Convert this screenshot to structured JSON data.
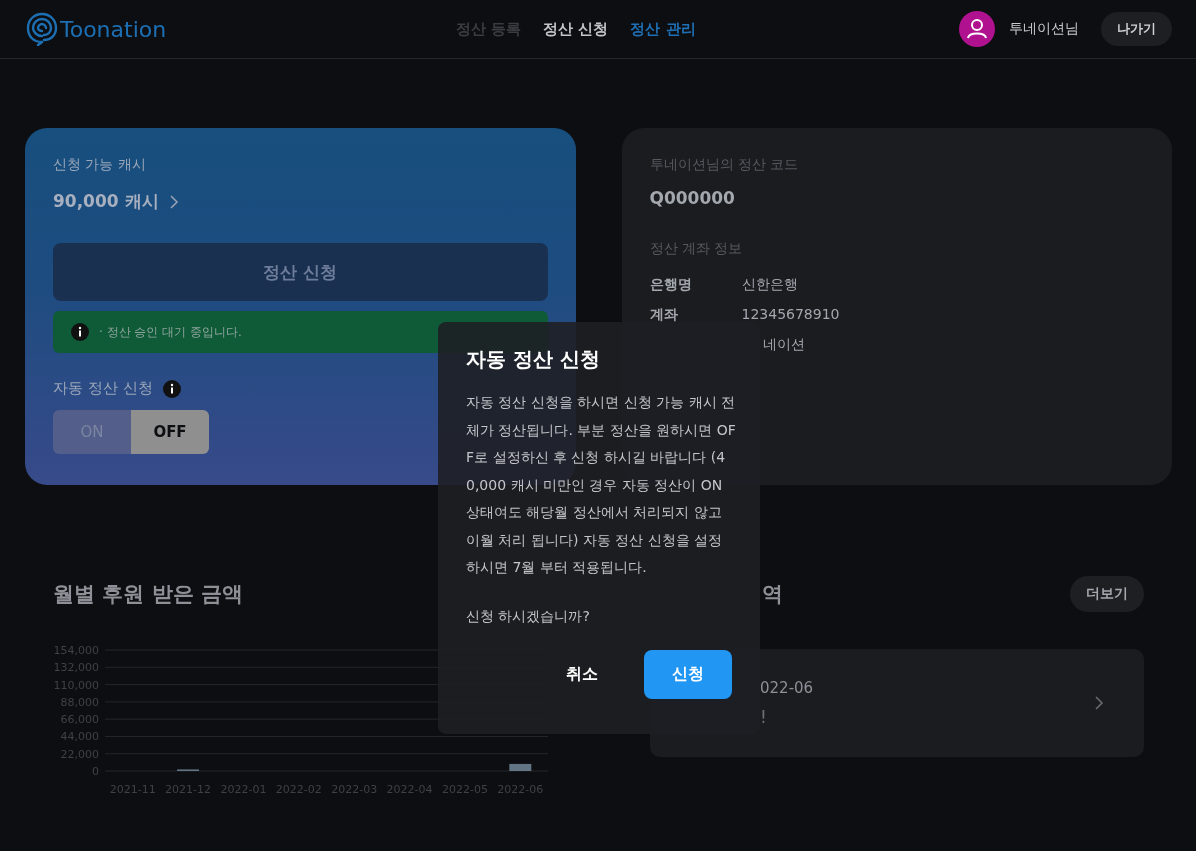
{
  "header": {
    "logo": "Toonation",
    "nav": [
      {
        "label": "정산 등록",
        "selected": false,
        "disabled": true
      },
      {
        "label": "정산 신청",
        "selected": false,
        "disabled": false
      },
      {
        "label": "정산 관리",
        "selected": true,
        "disabled": false
      }
    ],
    "user_name": "투네이션님",
    "logout": "나가기"
  },
  "cash_card": {
    "label": "신청 가능 캐시",
    "amount": "90,000 캐시",
    "apply_button": {
      "label": "정산 신청",
      "disabled": true
    },
    "notice": "· 정산 승인 대기 중입니다.",
    "auto_label": "자동 정산 신청",
    "toggle": [
      {
        "label": "ON",
        "selected": false
      },
      {
        "label": "OFF",
        "selected": true
      }
    ]
  },
  "code_card": {
    "title": "투네이션님의 정산 코드",
    "code": "Q000000",
    "account_title": "정산 계좌 정보",
    "rows": [
      {
        "label": "은행명",
        "value": "신한은행"
      },
      {
        "label": "계좌",
        "value": "12345678910"
      },
      {
        "value": "네이션"
      }
    ]
  },
  "monthly": {
    "title": "월별 후원 받은 금액",
    "chart_data": {
      "type": "bar",
      "categories": [
        "2021-11",
        "2021-12",
        "2022-01",
        "2022-02",
        "2022-03",
        "2022-04",
        "2022-05",
        "2022-06"
      ],
      "values": [
        0,
        2000,
        0,
        0,
        0,
        0,
        null,
        9000
      ],
      "ylim": [
        0,
        154000
      ],
      "grid": true,
      "yticks": [
        {
          "value": 0,
          "label": "0"
        },
        {
          "value": 22000,
          "label": "22,000"
        },
        {
          "value": 44000,
          "label": "44,000"
        },
        {
          "value": 66000,
          "label": "66,000"
        },
        {
          "value": 88000,
          "label": "88,000"
        },
        {
          "value": 110000,
          "label": "110,000"
        },
        {
          "value": 132000,
          "label": "132,000"
        },
        {
          "value": 154000,
          "label": "154,000"
        }
      ]
    }
  },
  "history": {
    "title": "역",
    "more": "더보기",
    "items": [
      {
        "date": "022-06",
        "status": "!"
      }
    ]
  },
  "dialog": {
    "title": "자동 정산 신청",
    "body": "자동 정산 신청을 하시면 신청 가능 캐시 전체가 정산됩니다. 부분 정산을 원하시면 OFF로 설정하신 후 신청 하시길 바랍니다 (40,000 캐시 미만인 경우 자동 정산이 ON 상태여도 해당월 정산에서 처리되지 않고 이월 처리 됩니다) 자동 정산 신청을 설정 하시면 7월 부터 적용됩니다.",
    "question": "신청 하시겠습니까?",
    "cancel": "취소",
    "confirm": "신청"
  }
}
